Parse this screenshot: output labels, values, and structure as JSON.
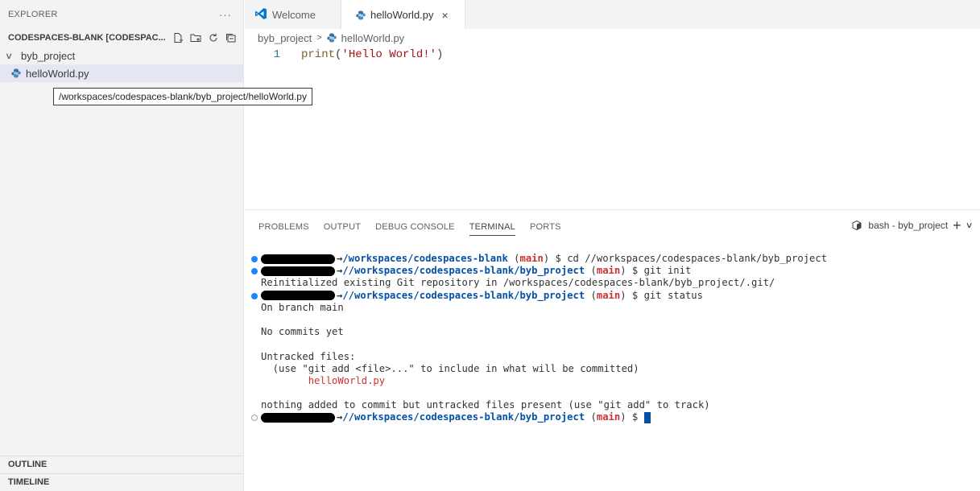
{
  "sidebar": {
    "title": "EXPLORER",
    "more": "···",
    "workspace": "CODESPACES-BLANK [CODESPAC...",
    "folder": "byb_project",
    "file": "helloWorld.py",
    "tooltip": "/workspaces/codespaces-blank/byb_project/helloWorld.py",
    "outline": "OUTLINE",
    "timeline": "TIMELINE"
  },
  "tabs": {
    "welcome": "Welcome",
    "hello": "helloWorld.py",
    "close": "×"
  },
  "breadcrumb": {
    "folder": "byb_project",
    "sep": ">",
    "file": "helloWorld.py"
  },
  "editor": {
    "line_number": "1",
    "code_fn": "print",
    "code_open": "(",
    "code_str": "'Hello World!'",
    "code_close": ")"
  },
  "panel": {
    "tabs": [
      "PROBLEMS",
      "OUTPUT",
      "DEBUG CONSOLE",
      "TERMINAL",
      "PORTS"
    ],
    "terminal_name": "bash - byb_project",
    "plus": "+",
    "chevron": "∨"
  },
  "terminal": {
    "arrow": "→",
    "l1_path": "/workspaces/codespaces-blank",
    "l1_branch": "main",
    "l1_cmd": " $ cd //workspaces/codespaces-blank/byb_project",
    "l2_path": "//workspaces/codespaces-blank/byb_project",
    "l2_branch": "main",
    "l2_cmd": " $ git init",
    "l3": "Reinitialized existing Git repository in /workspaces/codespaces-blank/byb_project/.git/",
    "l4_path": "//workspaces/codespaces-blank/byb_project",
    "l4_branch": "main",
    "l4_cmd": " $ git status",
    "l5": "On branch main",
    "l7": "No commits yet",
    "l9": "Untracked files:",
    "l10": "  (use \"git add <file>...\" to include in what will be committed)",
    "l11": "helloWorld.py",
    "l13": "nothing added to commit but untracked files present (use \"git add\" to track)",
    "l14_path": "//workspaces/codespaces-blank/byb_project",
    "l14_branch": "main",
    "l14_cmd": " $ "
  },
  "colors": {
    "path": "#0451a5",
    "branch": "#cd3131",
    "accent": "#1a85ff"
  }
}
